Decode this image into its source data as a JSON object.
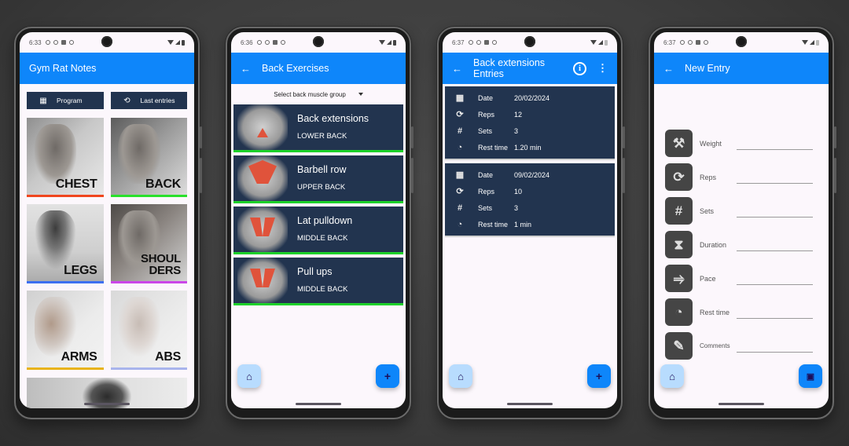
{
  "phones": [
    {
      "status_time": "6:33",
      "appbar": {
        "title": "Gym Rat Notes"
      },
      "buttons": [
        {
          "label": "Program",
          "icon": "calendar-icon"
        },
        {
          "label": "Last entries",
          "icon": "history-icon"
        }
      ],
      "tiles": [
        {
          "label": "CHEST",
          "accent": "#f0461e"
        },
        {
          "label": "BACK",
          "accent": "#29e02b"
        },
        {
          "label": "LEGS",
          "accent": "#3d6ff0"
        },
        {
          "label": "SHOUL\nDERS",
          "accent": "#cb46e8"
        },
        {
          "label": "ARMS",
          "accent": "#e8b31a"
        },
        {
          "label": "ABS",
          "accent": "#a8b4ec"
        }
      ]
    },
    {
      "status_time": "6:36",
      "appbar": {
        "title": "Back Exercises",
        "back_icon": "arrow-left-icon"
      },
      "dropdown": {
        "selected": "Select back muscle group"
      },
      "exercises": [
        {
          "name": "Back extensions",
          "group": "LOWER BACK"
        },
        {
          "name": "Barbell row",
          "group": "UPPER BACK"
        },
        {
          "name": "Lat pulldown",
          "group": "MIDDLE BACK"
        },
        {
          "name": "Pull ups",
          "group": "MIDDLE BACK"
        }
      ],
      "fab_home_icon": "home-icon",
      "fab_add_label": "+"
    },
    {
      "status_time": "6:37",
      "appbar": {
        "title": "Back extensions Entries",
        "info_label": "i",
        "more_label": "⋮"
      },
      "entries": [
        {
          "date_label": "Date",
          "date": "20/02/2024",
          "reps_label": "Reps",
          "reps": "12",
          "sets_label": "Sets",
          "sets": "3",
          "rest_label": "Rest time",
          "rest": "1.20 min"
        },
        {
          "date_label": "Date",
          "date": "09/02/2024",
          "reps_label": "Reps",
          "reps": "10",
          "sets_label": "Sets",
          "sets": "3",
          "rest_label": "Rest time",
          "rest": "1 min"
        }
      ],
      "fab_add_label": "+"
    },
    {
      "status_time": "6:37",
      "appbar": {
        "title": "New Entry"
      },
      "fields": [
        {
          "label": "Weight",
          "icon": "dumbbell-icon",
          "value": ""
        },
        {
          "label": "Reps",
          "icon": "repeat-icon",
          "value": ""
        },
        {
          "label": "Sets",
          "icon": "hash-icon",
          "value": ""
        },
        {
          "label": "Duration",
          "icon": "hourglass-icon",
          "value": ""
        },
        {
          "label": "Pace",
          "icon": "runner-icon",
          "value": ""
        },
        {
          "label": "Rest time",
          "icon": "timer-icon",
          "value": ""
        },
        {
          "label": "Comments",
          "icon": "note-icon",
          "value": ""
        }
      ],
      "fab_save_icon": "save-icon"
    }
  ],
  "glyphs": {
    "back": "←",
    "home": "⌂",
    "calendar": "▦",
    "history": "⟲",
    "repeat": "⟳",
    "hash": "#",
    "timer": "◔",
    "dumbbell": "⚒",
    "hourglass": "⧗",
    "runner": "⥤",
    "note": "✎",
    "save": "▣"
  }
}
